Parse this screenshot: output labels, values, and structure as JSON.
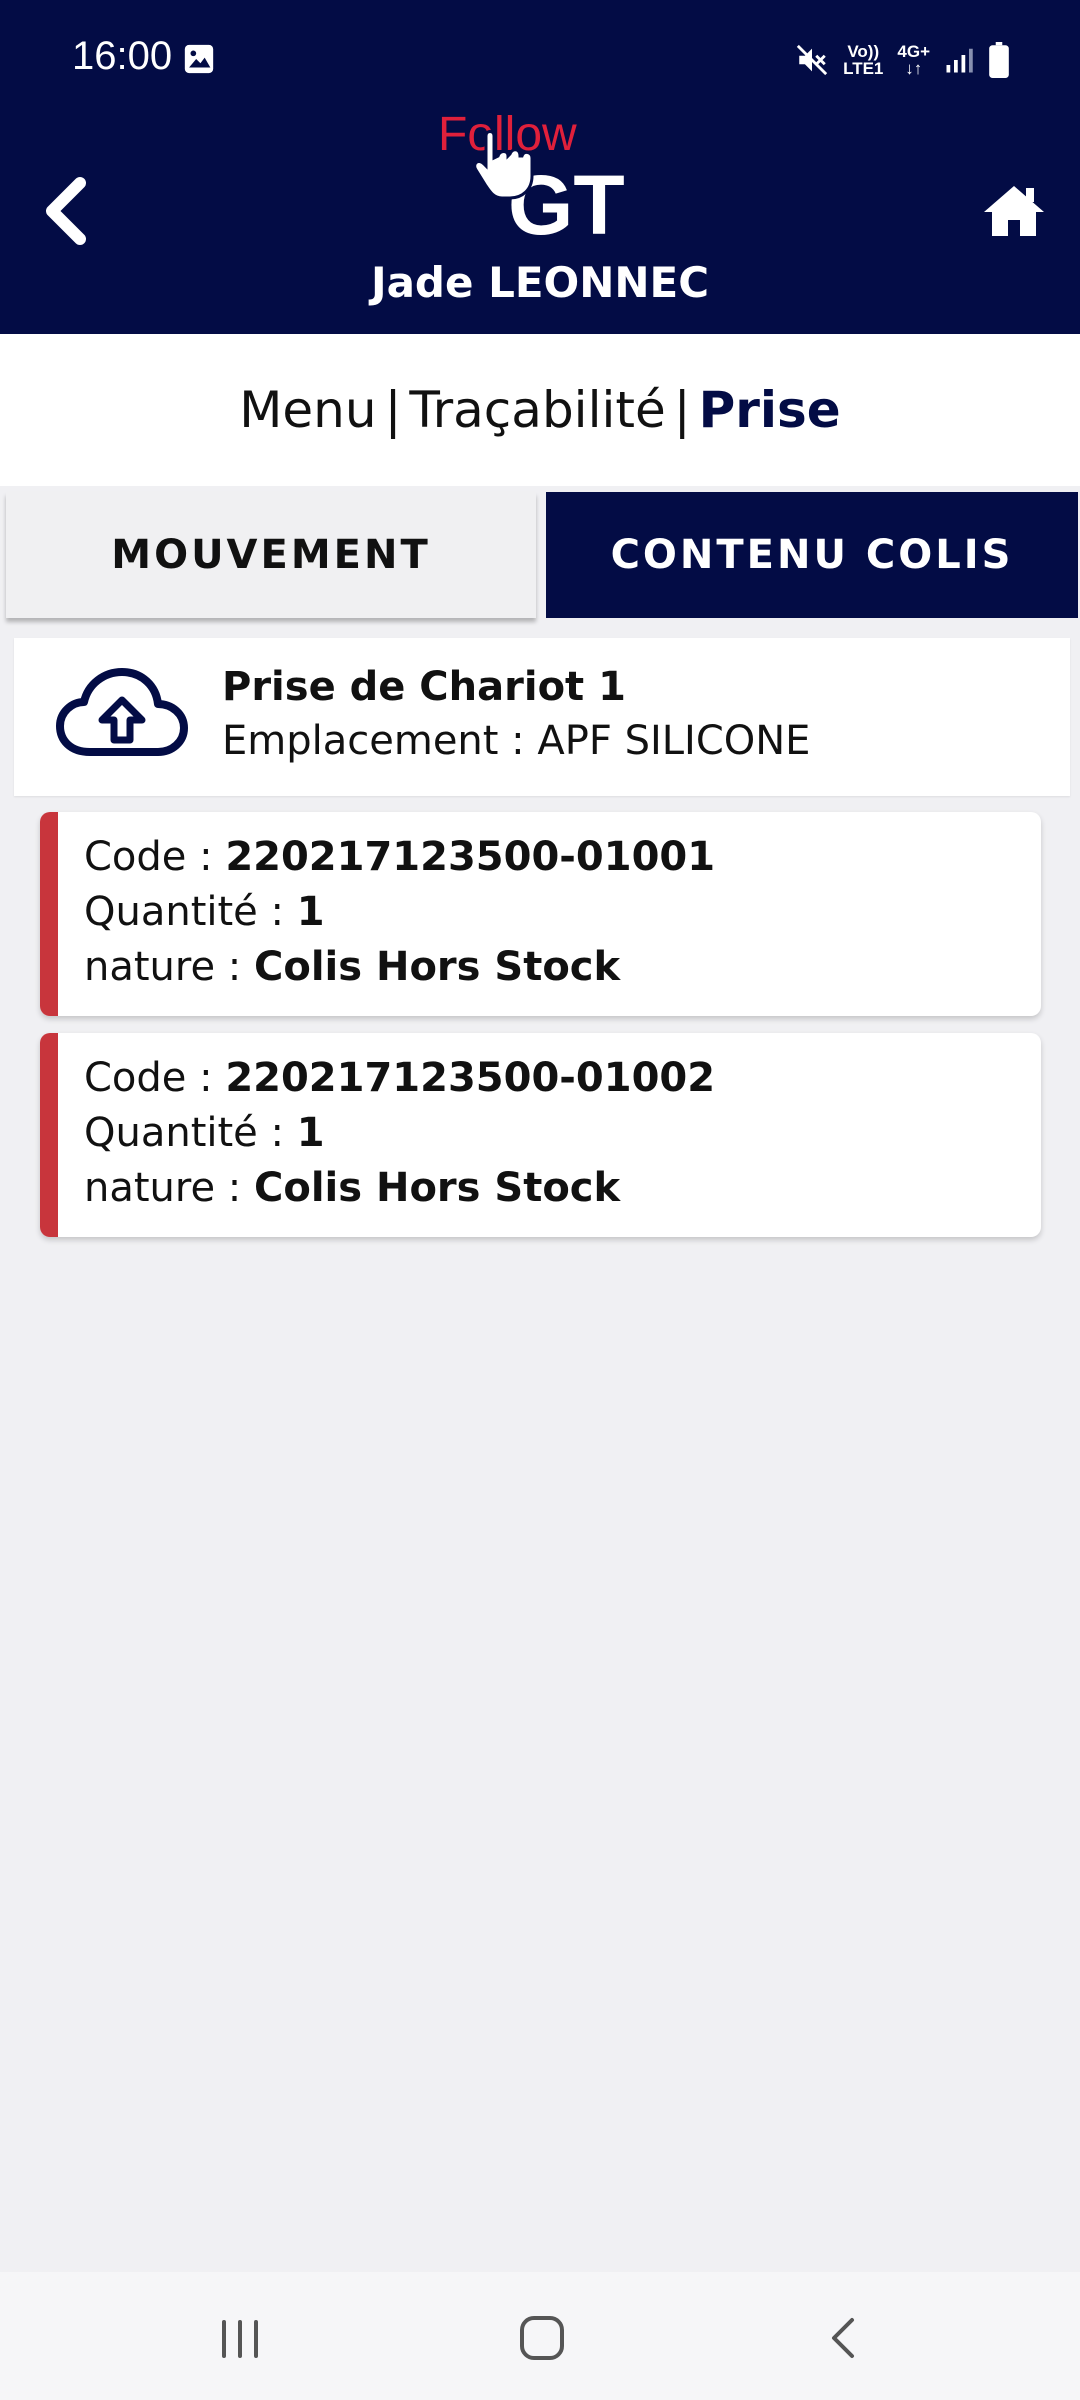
{
  "status_bar": {
    "time": "16:00",
    "network_top": "Vo))",
    "network_bottom": "LTE1",
    "network_type": "4G+",
    "icons": [
      "image-icon",
      "mute-icon",
      "signal-icon",
      "battery-icon"
    ]
  },
  "header": {
    "logo_text_top": "Follow",
    "logo_text_bottom": "GT",
    "user_name": "Jade LEONNEC",
    "colors": {
      "background": "#030c45",
      "logo_red": "#e0203b"
    }
  },
  "breadcrumb": {
    "items": [
      "Menu",
      "Traçabilité",
      "Prise"
    ],
    "separator": "|"
  },
  "tabs": [
    {
      "label": "MOUVEMENT",
      "active": false
    },
    {
      "label": "CONTENU COLIS",
      "active": true
    }
  ],
  "info_card": {
    "icon": "cloud-upload-icon",
    "title": "Prise de Chariot 1",
    "subtitle": "Emplacement : APF SILICONE"
  },
  "items": [
    {
      "code_label": "Code : ",
      "code": "220217123500-01001",
      "quantity_label": "Quantité : ",
      "quantity": "1",
      "nature_label": "nature : ",
      "nature": "Colis Hors Stock"
    },
    {
      "code_label": "Code : ",
      "code": "220217123500-01002",
      "quantity_label": "Quantité : ",
      "quantity": "1",
      "nature_label": "nature : ",
      "nature": "Colis Hors Stock"
    }
  ],
  "item_accent_color": "#c8353c",
  "nav_bar": {
    "buttons": [
      "recent-apps-icon",
      "home-circle-icon",
      "back-icon"
    ]
  }
}
